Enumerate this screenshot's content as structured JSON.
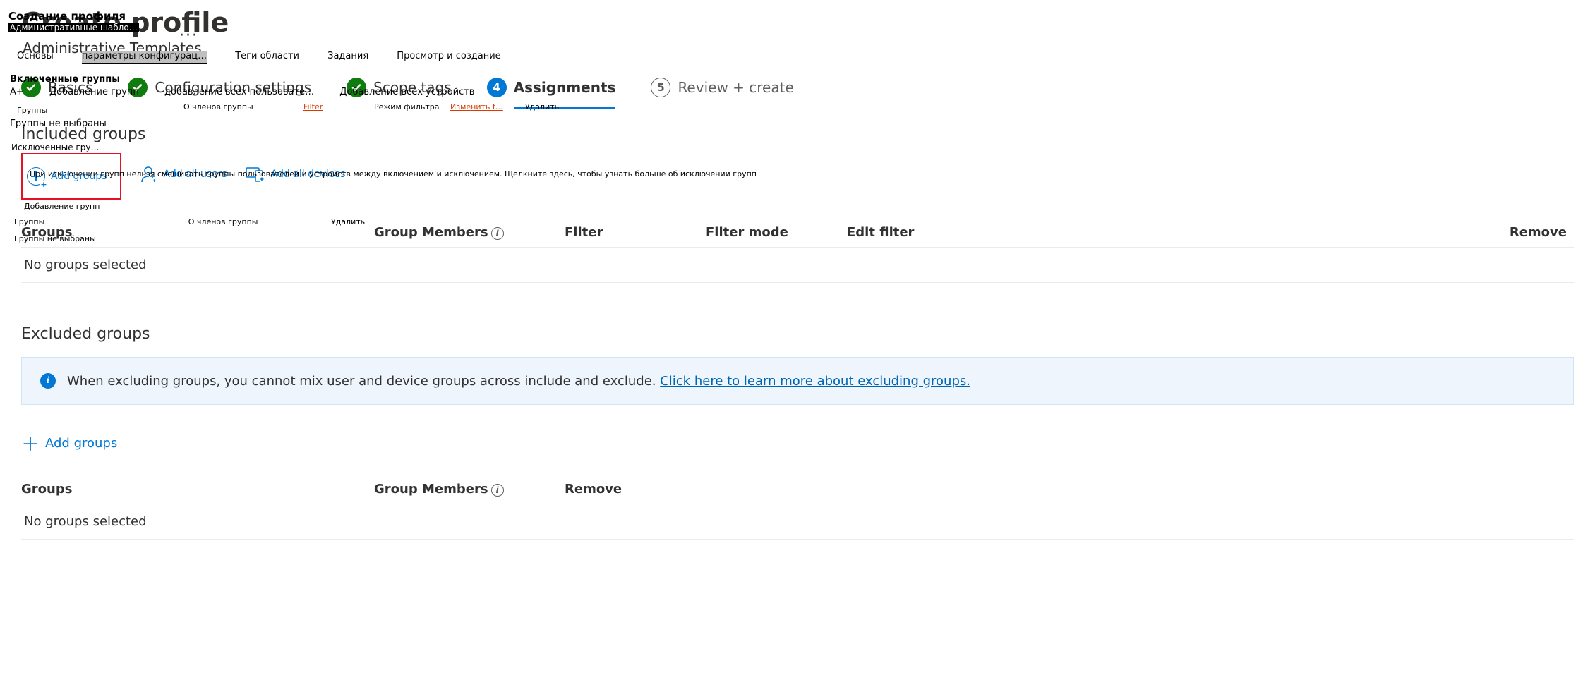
{
  "overlay": {
    "create_profile_ru": "Создание профиля",
    "admin_tpl_ru": "Административные шабло…",
    "tabs_ru": [
      "Основы",
      "параметры конфигурац…",
      "Теги области",
      "Задания",
      "Просмотр и создание"
    ],
    "active_tab_index_ru": 1,
    "included_groups_ru": "Включенные группы",
    "row1_ru": {
      "a_plus": "A+",
      "add_groups": "Добавление групп",
      "add_users": "добавление всех пользовате…",
      "add_devices": "Добавление всех устройств"
    },
    "row2_ru": {
      "groups": "Группы",
      "members": "О членов группы",
      "filter": "Filter",
      "filter_mode": "Режим фильтра",
      "edit_filter": "Изменить f…",
      "remove": "Удалить"
    },
    "no_sel_ru": "Группы не выбраны",
    "excluded_groups_ru": "Исключенные гру…",
    "excl_note_ru": "При исключении групп нельзя смешивать группы пользователей и устройств между включением и исключением. Щелкните здесь, чтобы узнать больше об исключении групп",
    "add_groups2_ru": "Добавление групп",
    "row3_ru": {
      "groups": "Группы",
      "members": "О членов группы",
      "remove": "Удалить"
    }
  },
  "page": {
    "title": "Create profile",
    "subtitle": "Administrative Templates",
    "more_label": "···"
  },
  "wizard": {
    "steps": [
      {
        "label": "Basics",
        "state": "done"
      },
      {
        "label": "Configuration settings",
        "state": "done"
      },
      {
        "label": "Scope tags",
        "state": "done"
      },
      {
        "label": "Assignments",
        "state": "current",
        "num": "4"
      },
      {
        "label": "Review + create",
        "state": "future",
        "num": "5"
      }
    ]
  },
  "included": {
    "heading": "Included groups",
    "actions": {
      "add_groups": "Add groups",
      "add_users": "Add all users",
      "add_devices": "Add all devices"
    },
    "columns": {
      "groups": "Groups",
      "members": "Group Members",
      "filter": "Filter",
      "filter_mode": "Filter mode",
      "edit_filter": "Edit filter",
      "remove": "Remove"
    },
    "empty": "No groups selected"
  },
  "excluded": {
    "heading": "Excluded groups",
    "info_text": "When excluding groups, you cannot mix user and device groups across include and exclude. ",
    "info_link": "Click here to learn more about excluding groups.",
    "add_groups": "Add groups",
    "columns": {
      "groups": "Groups",
      "members": "Group Members",
      "remove": "Remove"
    },
    "empty": "No groups selected"
  }
}
